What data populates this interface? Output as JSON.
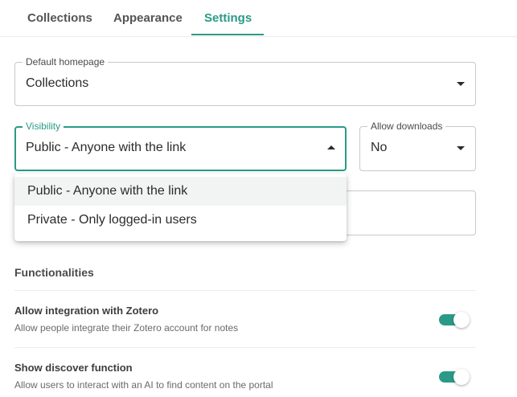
{
  "tabs": [
    {
      "label": "Collections"
    },
    {
      "label": "Appearance"
    },
    {
      "label": "Settings"
    }
  ],
  "active_tab": "Settings",
  "fields": {
    "default_homepage": {
      "label": "Default homepage",
      "value": "Collections"
    },
    "visibility": {
      "label": "Visibility",
      "value": "Public - Anyone with the link"
    },
    "allow_downloads": {
      "label": "Allow downloads",
      "value": "No"
    }
  },
  "visibility_menu": {
    "options": [
      {
        "label": "Public - Anyone with the link",
        "selected": true
      },
      {
        "label": "Private - Only logged-in users",
        "selected": false
      }
    ]
  },
  "functionalities": {
    "title": "Functionalities",
    "items": [
      {
        "title": "Allow integration with Zotero",
        "description": "Allow people integrate their Zotero account for notes",
        "enabled": true
      },
      {
        "title": "Show discover function",
        "description": "Allow users to interact with an AI to find content on the portal",
        "enabled": true
      }
    ]
  },
  "colors": {
    "accent": "#2a9a86",
    "border": "#c8c8c8",
    "text": "#2b2b2b"
  },
  "icons": {
    "dropdown_closed": "caret-down-icon",
    "dropdown_open": "caret-up-icon"
  }
}
